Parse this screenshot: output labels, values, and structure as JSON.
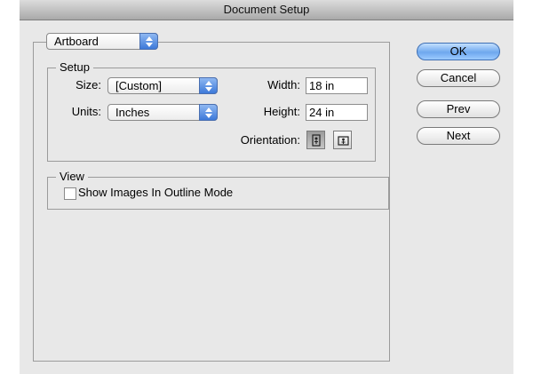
{
  "window": {
    "title": "Document Setup"
  },
  "category_popup": {
    "value": "Artboard"
  },
  "setup": {
    "group_title": "Setup",
    "size_label": "Size:",
    "size_value": "[Custom]",
    "units_label": "Units:",
    "units_value": "Inches",
    "width_label": "Width:",
    "width_value": "18 in",
    "height_label": "Height:",
    "height_value": "24 in",
    "orientation_label": "Orientation:"
  },
  "view": {
    "group_title": "View",
    "show_images_label": "Show Images In Outline Mode",
    "show_images_checked": false
  },
  "buttons": {
    "ok": "OK",
    "cancel": "Cancel",
    "prev": "Prev",
    "next": "Next"
  },
  "colors": {
    "accent": "#5a95e8",
    "window_bg": "#e8e8e8"
  },
  "icons": [
    "up-down-arrows-icon",
    "portrait-orientation-icon",
    "landscape-orientation-icon"
  ]
}
